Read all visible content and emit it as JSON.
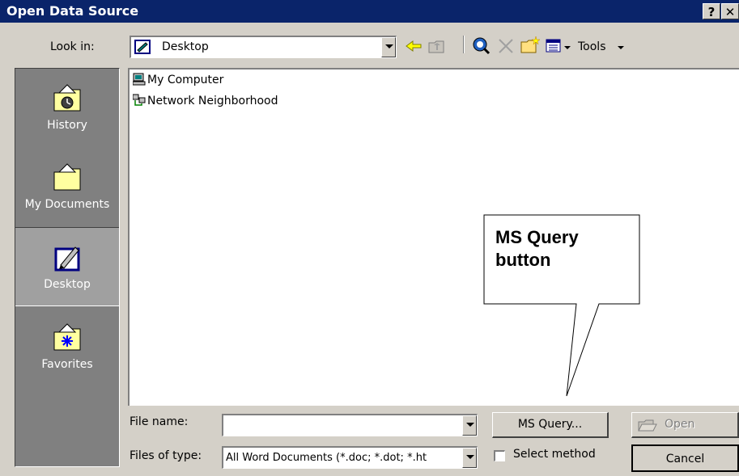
{
  "window": {
    "title": "Open Data Source",
    "help_button": "?",
    "close_button": "✕"
  },
  "toolbar": {
    "look_in_label": "Look in:",
    "look_in_value": "Desktop",
    "tools_label": "Tools",
    "icons": [
      "back-arrow-icon",
      "up-folder-icon",
      "search-web-icon",
      "delete-icon",
      "new-folder-icon",
      "views-icon",
      "tools-dropdown"
    ]
  },
  "places": [
    {
      "label": "History",
      "icon": "history-folder-icon"
    },
    {
      "label": "My Documents",
      "icon": "documents-folder-icon"
    },
    {
      "label": "Desktop",
      "icon": "desktop-icon",
      "selected": true
    },
    {
      "label": "Favorites",
      "icon": "favorites-folder-icon"
    }
  ],
  "files": [
    {
      "name": "My Computer",
      "icon": "computer-icon"
    },
    {
      "name": "Network Neighborhood",
      "icon": "network-icon"
    }
  ],
  "form": {
    "file_name_label": "File name:",
    "file_name_value": "",
    "files_of_type_label": "Files of type:",
    "files_of_type_value": "All Word Documents (*.doc; *.dot; *.ht",
    "select_method_label": "Select method",
    "select_method_checked": false
  },
  "buttons": {
    "ms_query": "MS Query...",
    "open": "Open",
    "cancel": "Cancel"
  },
  "callout": {
    "line1": "MS Query",
    "line2": "button"
  },
  "colors": {
    "titlebar": "#0a246a",
    "face": "#d4d0c8",
    "places_bar": "#808080"
  }
}
